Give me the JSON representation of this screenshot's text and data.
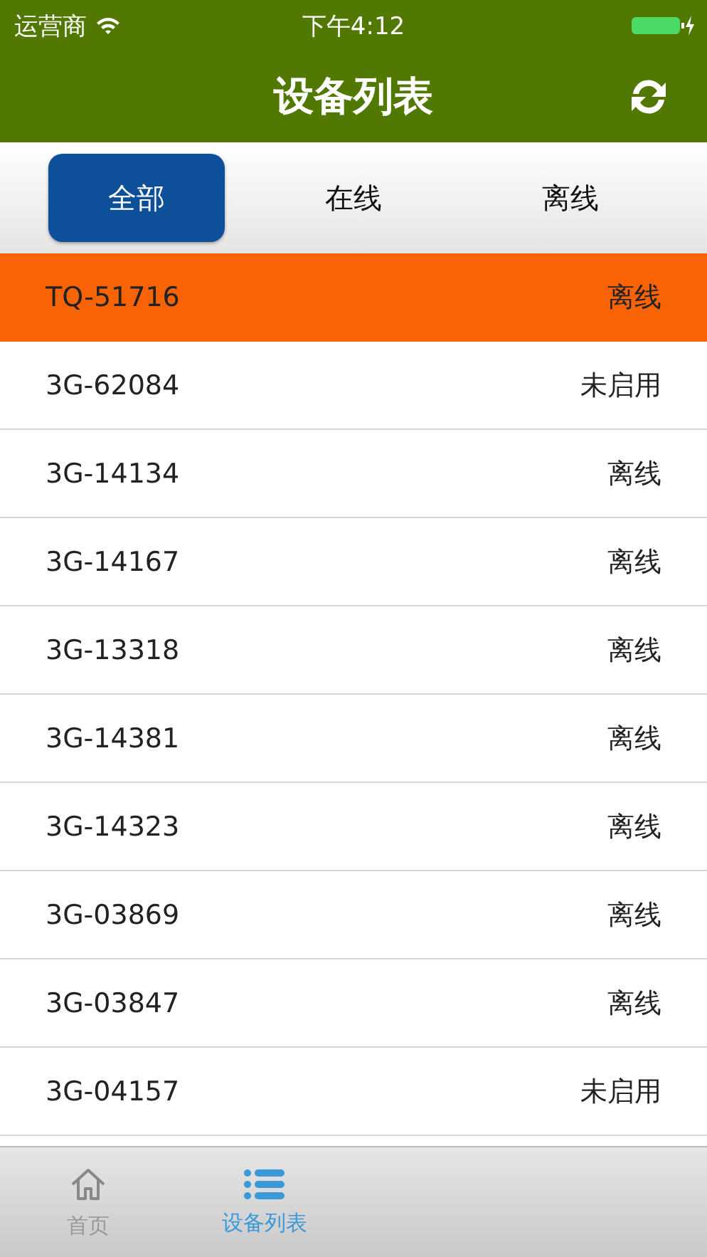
{
  "status_bar": {
    "carrier": "运营商",
    "time": "下午4:12"
  },
  "nav": {
    "title": "设备列表"
  },
  "filters": [
    {
      "label": "全部",
      "selected": true
    },
    {
      "label": "在线",
      "selected": false
    },
    {
      "label": "离线",
      "selected": false
    }
  ],
  "devices": [
    {
      "name": "TQ-51716",
      "status": "离线",
      "selected": true
    },
    {
      "name": "3G-62084",
      "status": "未启用",
      "selected": false
    },
    {
      "name": "3G-14134",
      "status": "离线",
      "selected": false
    },
    {
      "name": "3G-14167",
      "status": "离线",
      "selected": false
    },
    {
      "name": "3G-13318",
      "status": "离线",
      "selected": false
    },
    {
      "name": "3G-14381",
      "status": "离线",
      "selected": false
    },
    {
      "name": "3G-14323",
      "status": "离线",
      "selected": false
    },
    {
      "name": "3G-03869",
      "status": "离线",
      "selected": false
    },
    {
      "name": "3G-03847",
      "status": "离线",
      "selected": false
    },
    {
      "name": "3G-04157",
      "status": "未启用",
      "selected": false
    }
  ],
  "tab_bar": [
    {
      "kind": "home",
      "label": "首页",
      "selected": false
    },
    {
      "kind": "list",
      "label": "设备列表",
      "selected": true
    }
  ]
}
